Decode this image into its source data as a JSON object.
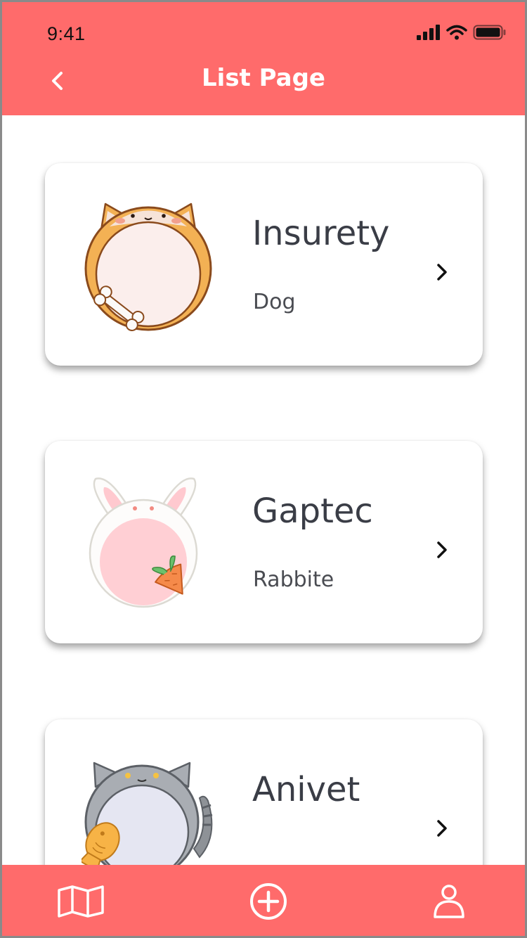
{
  "status_bar": {
    "time": "9:41"
  },
  "header": {
    "title": "List Page"
  },
  "colors": {
    "accent": "#ff6b6b",
    "card_bg": "#ffffff",
    "text_dark": "#3a3d46"
  },
  "list": {
    "items": [
      {
        "name": "Insurety",
        "type": "Dog",
        "avatar": "shiba-dog-avatar"
      },
      {
        "name": "Gaptec",
        "type": "Rabbite",
        "avatar": "bunny-avatar"
      },
      {
        "name": "Anivet",
        "type": "",
        "avatar": "cat-avatar"
      }
    ]
  },
  "tabbar": {
    "icons": [
      "map-icon",
      "add-circle-icon",
      "user-icon"
    ]
  }
}
